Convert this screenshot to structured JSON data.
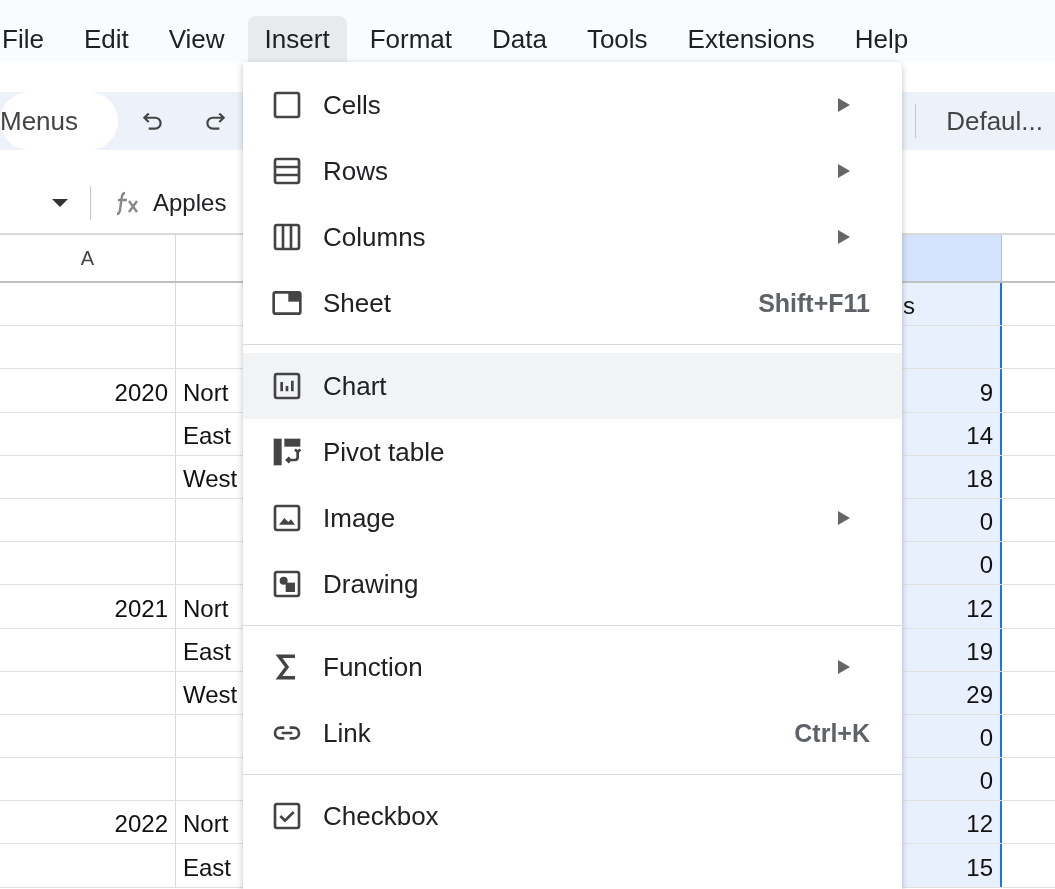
{
  "menu_bar": [
    {
      "label": "File",
      "selected": false
    },
    {
      "label": "Edit",
      "selected": false
    },
    {
      "label": "View",
      "selected": false
    },
    {
      "label": "Insert",
      "selected": true
    },
    {
      "label": "Format",
      "selected": false
    },
    {
      "label": "Data",
      "selected": false
    },
    {
      "label": "Tools",
      "selected": false
    },
    {
      "label": "Extensions",
      "selected": false
    },
    {
      "label": "Help",
      "selected": false
    }
  ],
  "toolbar": {
    "search_label": "Menus",
    "font": "Defaul..."
  },
  "formula_bar": {
    "value": "Apples"
  },
  "sheet": {
    "column_header": "A",
    "column_5_selected": true,
    "rows": [
      {
        "column_1": "",
        "column_2": "",
        "column_5": "s"
      },
      {
        "column_1": "",
        "column_2": "",
        "column_5": ""
      },
      {
        "column_1": "2020",
        "column_2": "Nort",
        "column_5": "9"
      },
      {
        "column_1": "",
        "column_2": "East",
        "column_5": "14"
      },
      {
        "column_1": "",
        "column_2": "West",
        "column_5": "18"
      },
      {
        "column_1": "",
        "column_2": "",
        "column_5": "0"
      },
      {
        "column_1": "",
        "column_2": "",
        "column_5": "0"
      },
      {
        "column_1": "2021",
        "column_2": "Nort",
        "column_5": "12"
      },
      {
        "column_1": "",
        "column_2": "East",
        "column_5": "19"
      },
      {
        "column_1": "",
        "column_2": "West",
        "column_5": "29"
      },
      {
        "column_1": "",
        "column_2": "",
        "column_5": "0"
      },
      {
        "column_1": "",
        "column_2": "",
        "column_5": "0"
      },
      {
        "column_1": "2022",
        "column_2": "Nort",
        "column_5": "12"
      },
      {
        "column_1": "",
        "column_2": "East",
        "column_5": "15"
      }
    ]
  },
  "insert_menu": {
    "groups": [
      [
        {
          "kind": "cells",
          "label": "Cells",
          "submenu": true,
          "highlighted": false
        },
        {
          "kind": "rows",
          "label": "Rows",
          "submenu": true,
          "highlighted": false
        },
        {
          "kind": "columns",
          "label": "Columns",
          "submenu": true,
          "highlighted": false
        },
        {
          "kind": "sheet",
          "label": "Sheet",
          "shortcut": "Shift+F11",
          "submenu": false,
          "highlighted": false
        }
      ],
      [
        {
          "kind": "chart",
          "label": "Chart",
          "submenu": false,
          "highlighted": true
        },
        {
          "kind": "pivot",
          "label": "Pivot table",
          "submenu": false,
          "highlighted": false
        },
        {
          "kind": "image",
          "label": "Image",
          "submenu": true,
          "highlighted": false
        },
        {
          "kind": "drawing",
          "label": "Drawing",
          "submenu": false,
          "highlighted": false
        }
      ],
      [
        {
          "kind": "function",
          "label": "Function",
          "submenu": true,
          "highlighted": false
        },
        {
          "kind": "link",
          "label": "Link",
          "shortcut": "Ctrl+K",
          "submenu": false,
          "highlighted": false
        }
      ],
      [
        {
          "kind": "checkbox",
          "label": "Checkbox",
          "submenu": false,
          "highlighted": false
        }
      ]
    ]
  }
}
